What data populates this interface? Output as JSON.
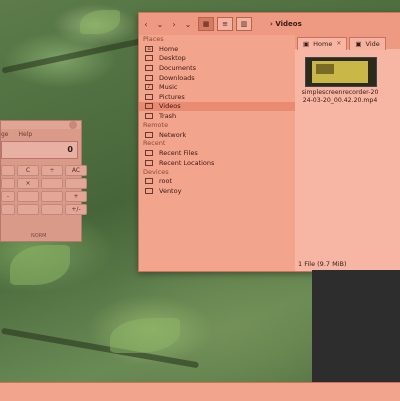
{
  "calculator": {
    "menu": [
      "ge",
      "Help"
    ],
    "display": "0",
    "keys": [
      "",
      "C",
      "÷",
      "AC",
      "",
      "×",
      "",
      "",
      "-",
      "",
      "",
      "+",
      "",
      "",
      "",
      "+/-"
    ],
    "mode": "NORM"
  },
  "file_manager": {
    "path": "Videos",
    "sidebar": {
      "places_header": "Places",
      "places": [
        "Home",
        "Desktop",
        "Documents",
        "Downloads",
        "Music",
        "Pictures",
        "Videos",
        "Trash"
      ],
      "remote_header": "Remote",
      "remote": [
        "Network"
      ],
      "recent_header": "Recent",
      "recent": [
        "Recent Files",
        "Recent Locations"
      ],
      "devices_header": "Devices",
      "devices": [
        "root",
        "Ventoy"
      ]
    },
    "tabs": [
      "Home",
      "Vide"
    ],
    "file": {
      "name": "simplescreenrecorder-2024-03-20_00.42.20.mp4"
    },
    "status": "1 File (9.7 MiB)"
  }
}
